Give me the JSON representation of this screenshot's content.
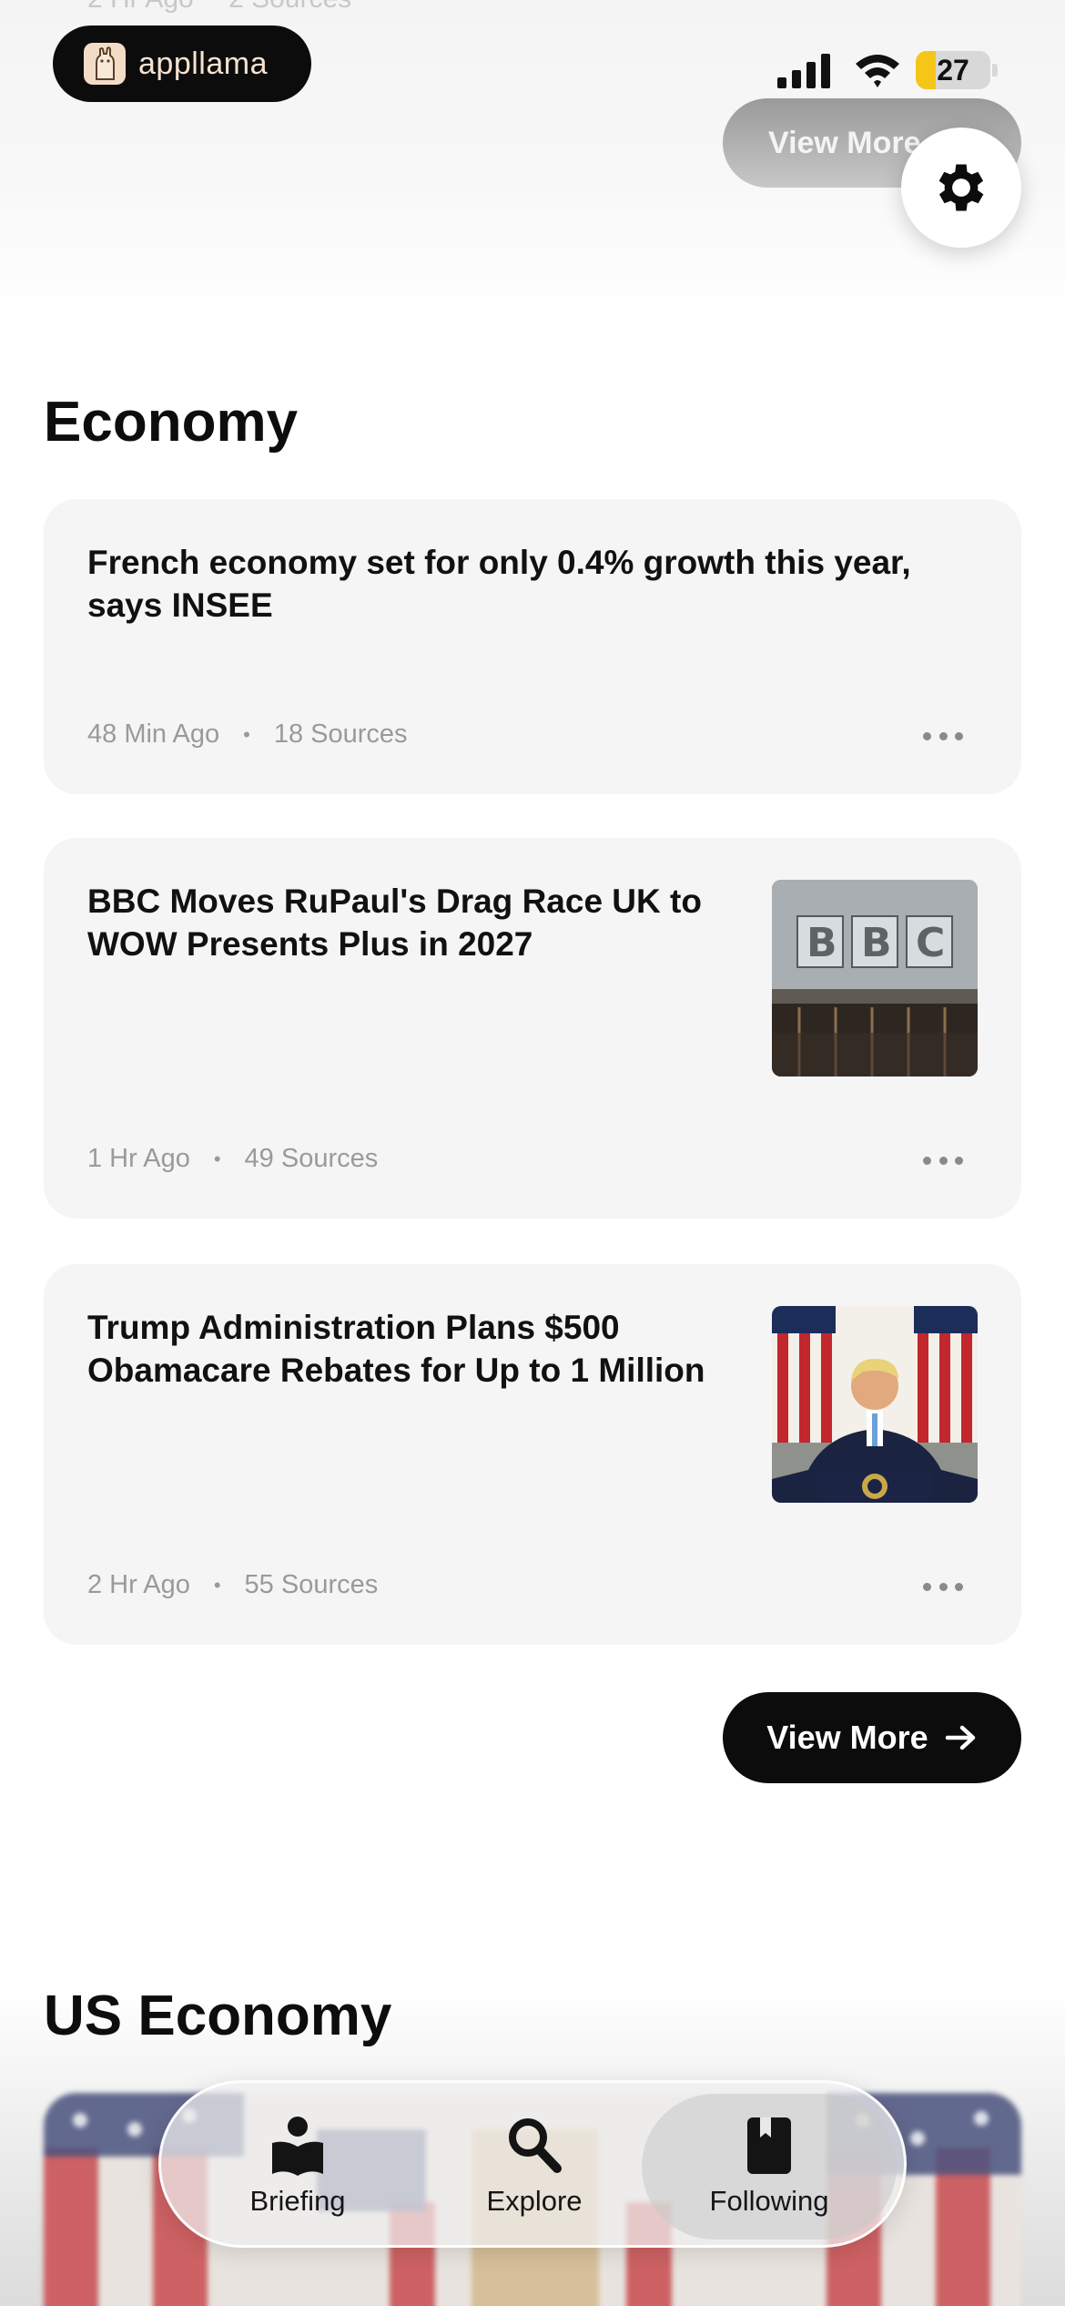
{
  "status_bar": {
    "app_badge": "appllama",
    "battery": "27",
    "battery_level": 0.27
  },
  "previous_section": {
    "meta_time": "2 Hr Ago",
    "meta_sources": "2 Sources",
    "view_more_label": "View More"
  },
  "economy": {
    "title": "Economy",
    "articles": [
      {
        "headline": "French economy set for only 0.4% growth this year, says INSEE",
        "time": "48 Min Ago",
        "sources": "18 Sources",
        "has_image": false
      },
      {
        "headline": "BBC Moves RuPaul's Drag Race UK to WOW Presents Plus in 2027",
        "time": "1 Hr Ago",
        "sources": "49 Sources",
        "has_image": true
      },
      {
        "headline": "Trump Administration Plans $500 Obamacare Rebates for Up to 1 Million",
        "time": "2 Hr Ago",
        "sources": "55 Sources",
        "has_image": true
      }
    ],
    "separator": "•",
    "view_more_label": "View More"
  },
  "us_economy": {
    "title": "US Economy"
  },
  "tab_bar": {
    "tabs": [
      {
        "label": "Briefing",
        "icon": "book-person-icon",
        "active": false
      },
      {
        "label": "Explore",
        "icon": "search-icon",
        "active": false
      },
      {
        "label": "Following",
        "icon": "bookmark-book-icon",
        "active": true
      }
    ]
  },
  "colors": {
    "card_bg": "#f5f5f5",
    "button_dark": "#0c0c0c",
    "meta_gray": "#9a9a9a",
    "battery_yellow": "#f5c518"
  }
}
